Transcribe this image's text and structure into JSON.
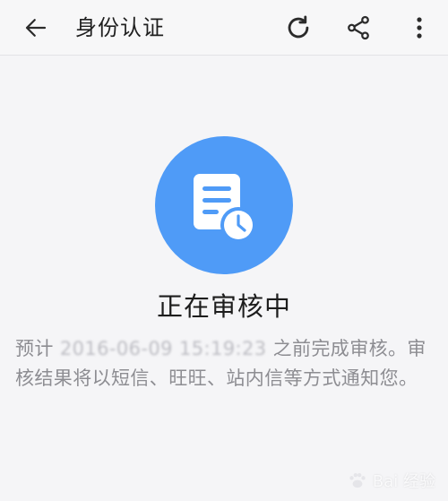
{
  "toolbar": {
    "title": "身份认证",
    "icons": {
      "back": "arrow-left-icon",
      "refresh": "refresh-icon",
      "share": "share-icon",
      "more": "more-vertical-icon"
    }
  },
  "status": {
    "title": "正在审核中",
    "icon": "document-clock-icon",
    "accent_color": "#4f9bf7"
  },
  "description": {
    "prefix": "预计 ",
    "estimated_time": "2016-06-09 15:19:23",
    "suffix": " 之前完成审核。审核结果将以短信、旺旺、站内信等方式通知您。"
  },
  "watermark": {
    "text": "Bai 经验"
  }
}
